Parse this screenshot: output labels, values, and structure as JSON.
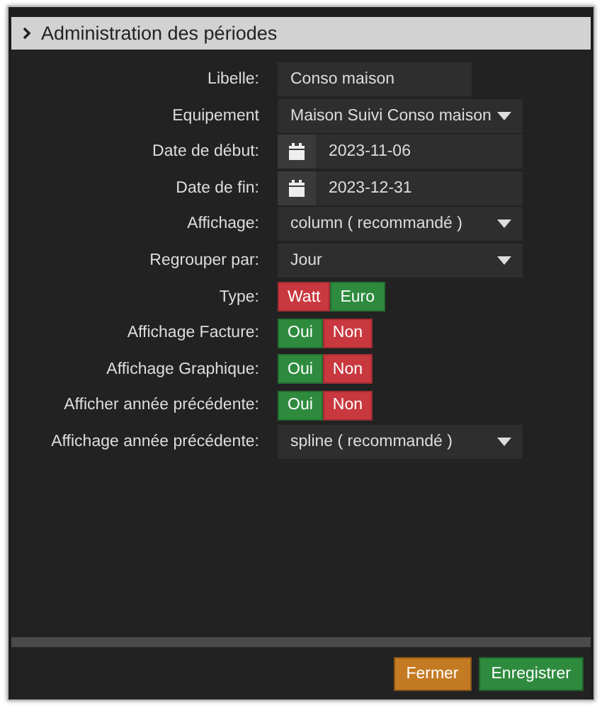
{
  "dialog": {
    "title": "Administration des périodes"
  },
  "rows": [
    {
      "kind": "text",
      "label": "Libelle:",
      "value": "Conso maison"
    },
    {
      "kind": "select",
      "label": "Equipement",
      "value": "Maison Suivi Conso maison"
    },
    {
      "kind": "date",
      "label": "Date de début:",
      "value": "2023-11-06"
    },
    {
      "kind": "date",
      "label": "Date de fin:",
      "value": "2023-12-31"
    },
    {
      "kind": "select",
      "label": "Affichage:",
      "value": "column ( recommandé )"
    },
    {
      "kind": "select",
      "label": "Regrouper par:",
      "value": "Jour"
    },
    {
      "kind": "toggle",
      "label": "Type:",
      "options": [
        {
          "label": "Watt",
          "color": "#c9383f"
        },
        {
          "label": "Euro",
          "color": "#2e8b3e"
        }
      ]
    },
    {
      "kind": "toggle",
      "label": "Affichage Facture:",
      "options": [
        {
          "label": "Oui",
          "color": "#2e8b3e"
        },
        {
          "label": "Non",
          "color": "#c9383f"
        }
      ]
    },
    {
      "kind": "toggle",
      "label": "Affichage Graphique:",
      "options": [
        {
          "label": "Oui",
          "color": "#2e8b3e"
        },
        {
          "label": "Non",
          "color": "#c9383f"
        }
      ]
    },
    {
      "kind": "toggle",
      "label": "Afficher année précédente:",
      "options": [
        {
          "label": "Oui",
          "color": "#2e8b3e"
        },
        {
          "label": "Non",
          "color": "#c9383f"
        }
      ]
    },
    {
      "kind": "select",
      "label": "Affichage année précédente:",
      "value": "spline ( recommandé )"
    }
  ],
  "buttons": [
    {
      "label": "Fermer",
      "kind": "close"
    },
    {
      "label": "Enregistrer",
      "kind": "save"
    }
  ]
}
